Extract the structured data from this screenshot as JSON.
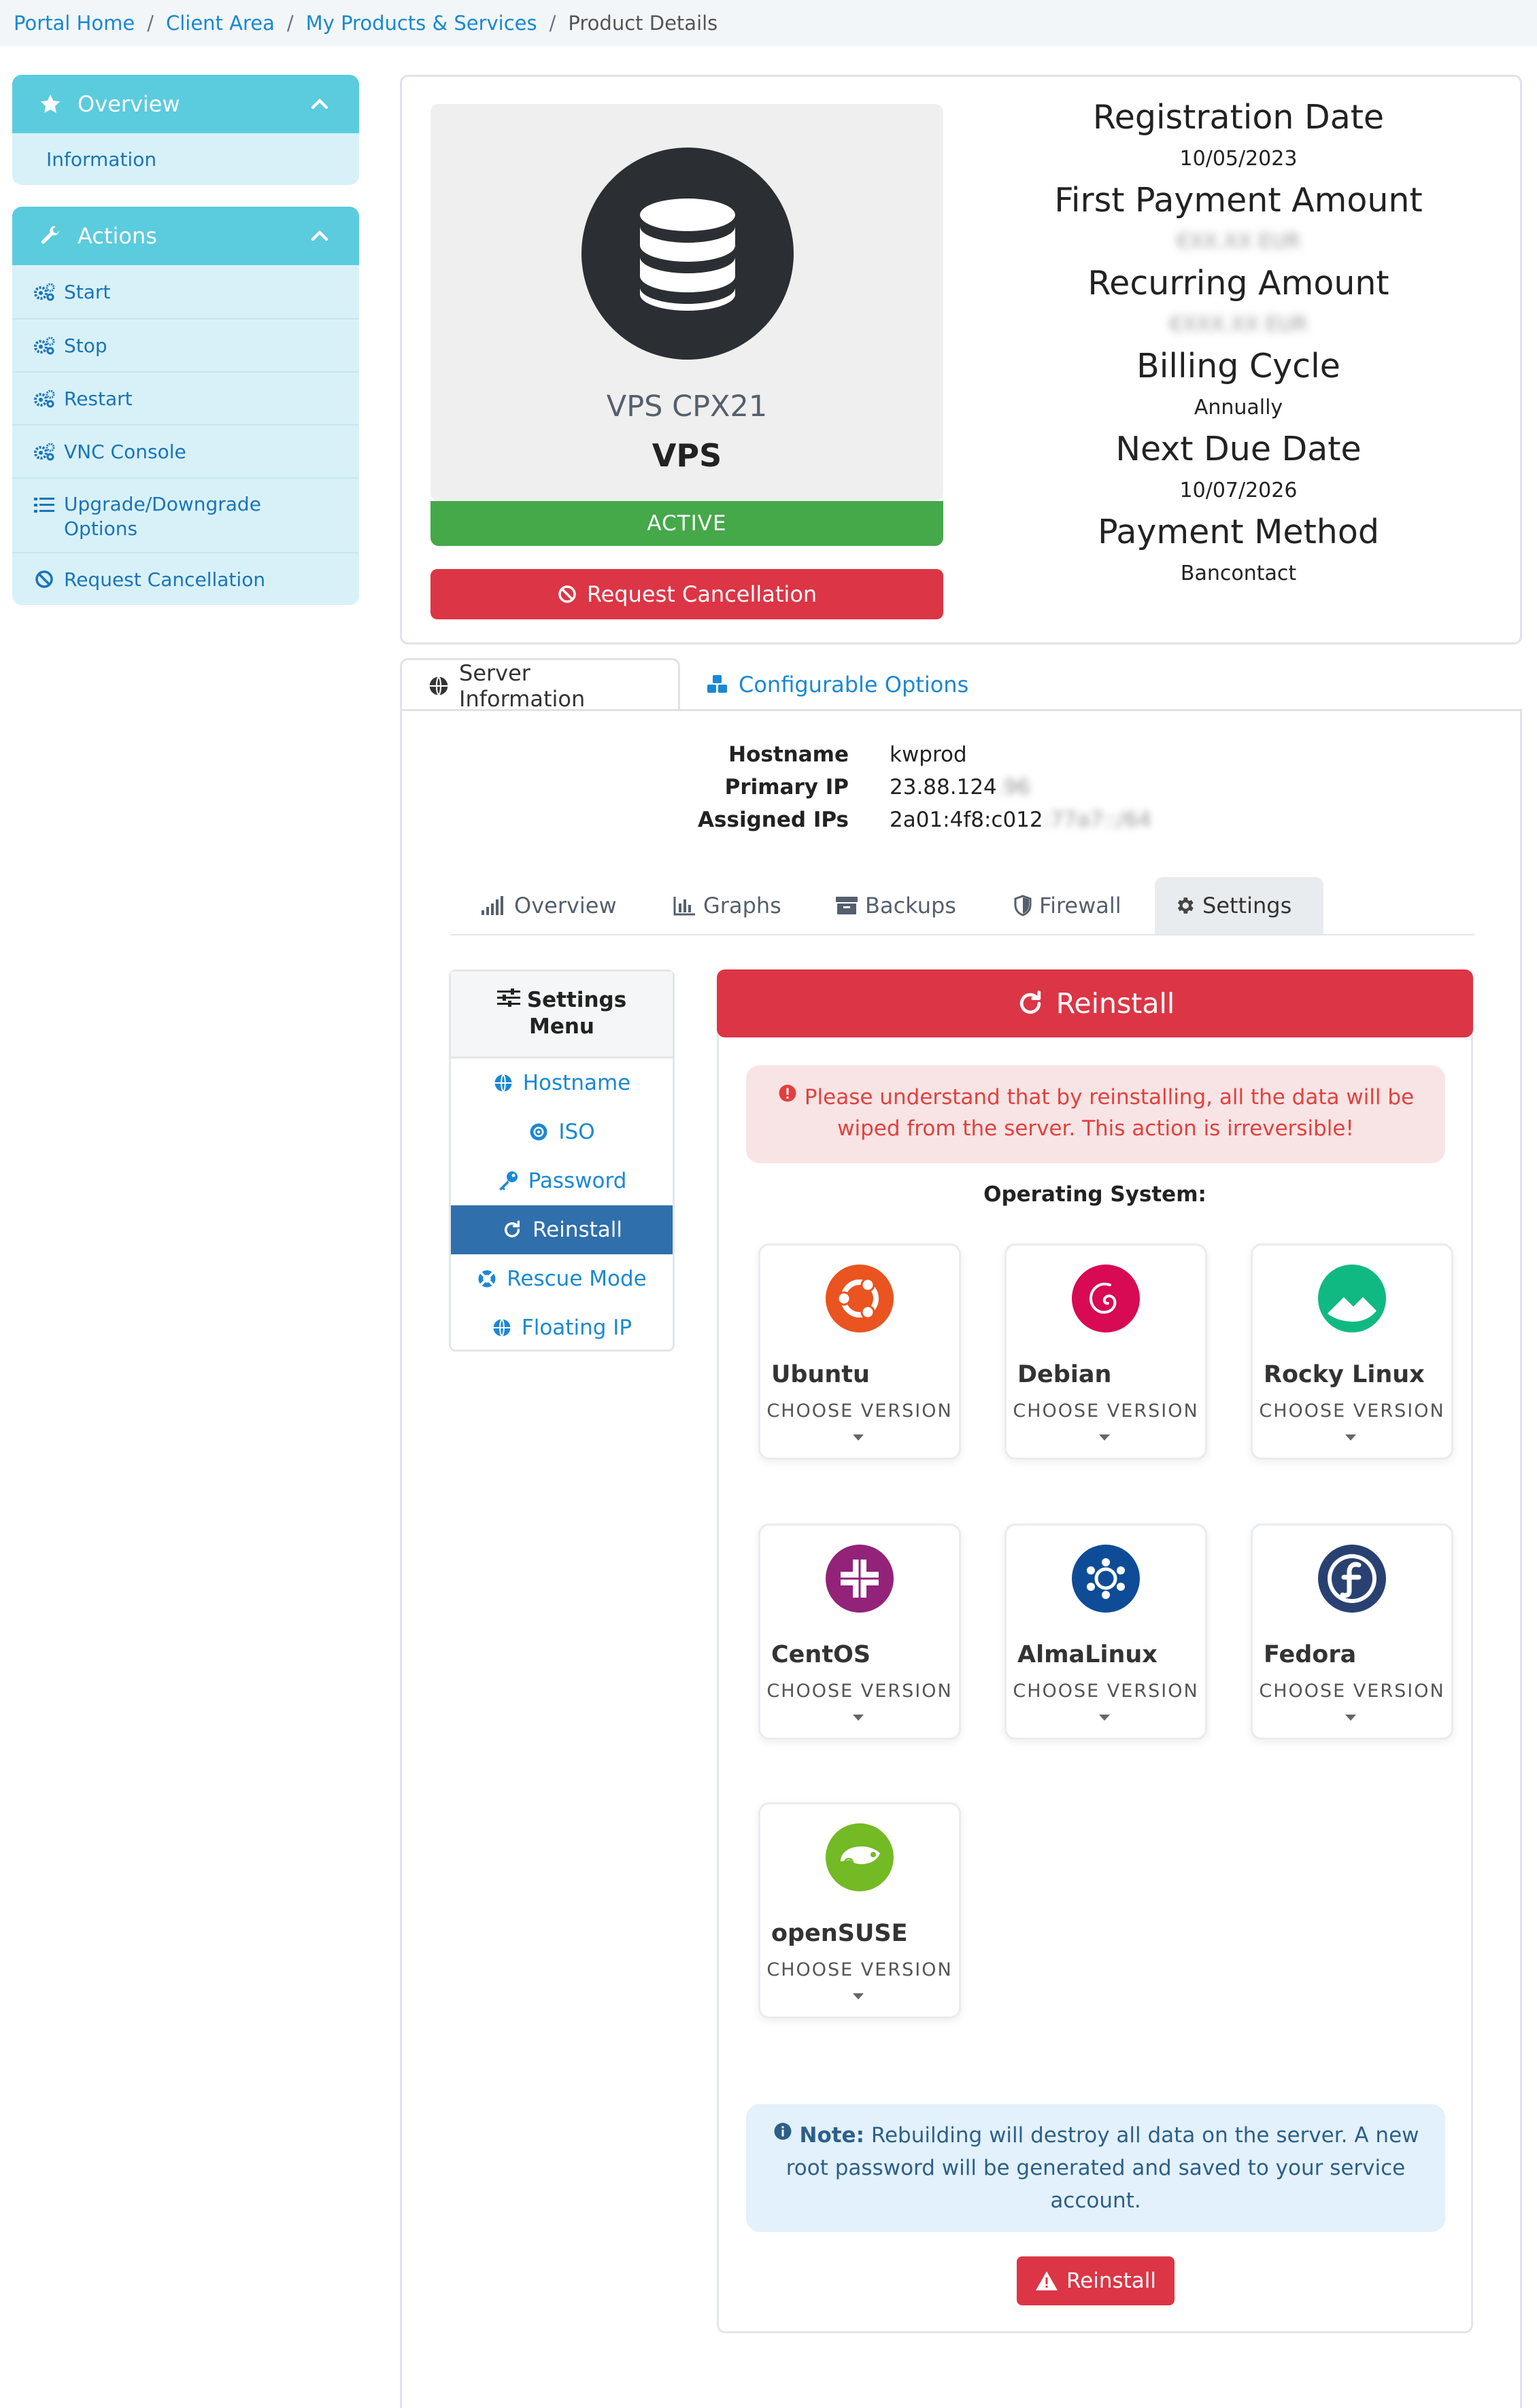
{
  "breadcrumb": {
    "items": [
      "Portal Home",
      "Client Area",
      "My Products & Services"
    ],
    "current": "Product Details",
    "separator": "/"
  },
  "sidebar": {
    "overview": {
      "title": "Overview",
      "items": [
        "Information"
      ]
    },
    "actions": {
      "title": "Actions",
      "items": [
        "Start",
        "Stop",
        "Restart",
        "VNC Console",
        "Upgrade/Downgrade Options",
        "Request Cancellation"
      ]
    }
  },
  "product": {
    "name": "VPS CPX21",
    "type": "VPS",
    "status": "ACTIVE",
    "cancel_label": "Request Cancellation"
  },
  "billing": {
    "registration_date_label": "Registration Date",
    "registration_date": "10/05/2023",
    "first_payment_label": "First Payment Amount",
    "first_payment": "€XX.XX EUR",
    "recurring_label": "Recurring Amount",
    "recurring": "€XXX.XX EUR",
    "cycle_label": "Billing Cycle",
    "cycle": "Annually",
    "next_due_label": "Next Due Date",
    "next_due": "10/07/2026",
    "payment_method_label": "Payment Method",
    "payment_method": "Bancontact"
  },
  "tabs": {
    "server_info": "Server Information",
    "config_options": "Configurable Options"
  },
  "server": {
    "hostname_label": "Hostname",
    "hostname": "kwprod",
    "primary_ip_label": "Primary IP",
    "primary_ip": "23.88.124",
    "primary_ip_hidden": ".96",
    "assigned_ips_label": "Assigned IPs",
    "assigned_ips": "2a01:4f8:c012",
    "assigned_ips_hidden": ":77a7::/64"
  },
  "subtabs": [
    "Overview",
    "Graphs",
    "Backups",
    "Firewall",
    "Settings"
  ],
  "settings_menu": {
    "title_line1": "Settings",
    "title_line2": "Menu",
    "items": [
      "Hostname",
      "ISO",
      "Password",
      "Reinstall",
      "Rescue Mode",
      "Floating IP"
    ],
    "active": "Reinstall"
  },
  "reinstall": {
    "title": "Reinstall",
    "warning_line1": "Please understand that by reinstalling, all the data will be",
    "warning_line2": "wiped from the server. This action is irreversible!",
    "os_title": "Operating System:",
    "choose_version": "CHOOSE VERSION",
    "os": [
      {
        "name": "Ubuntu",
        "color": "#e95420"
      },
      {
        "name": "Debian",
        "color": "#d70a53"
      },
      {
        "name": "Rocky Linux",
        "color": "#10b981"
      },
      {
        "name": "CentOS",
        "color": "#932279"
      },
      {
        "name": "AlmaLinux",
        "color": "#0f4c97"
      },
      {
        "name": "Fedora",
        "color": "#294172"
      },
      {
        "name": "openSUSE",
        "color": "#73ba25"
      }
    ],
    "note_bold": "Note:",
    "note_line1": " Rebuilding will destroy all data on the server. A new",
    "note_line2": "root password will be generated and saved to your service",
    "note_line3": "account.",
    "button_label": "Reinstall"
  },
  "colors": {
    "accent": "#5bcbde",
    "link": "#1a88d4",
    "danger": "#dc3545",
    "success": "#45a849",
    "active_menu": "#2f6fab"
  }
}
